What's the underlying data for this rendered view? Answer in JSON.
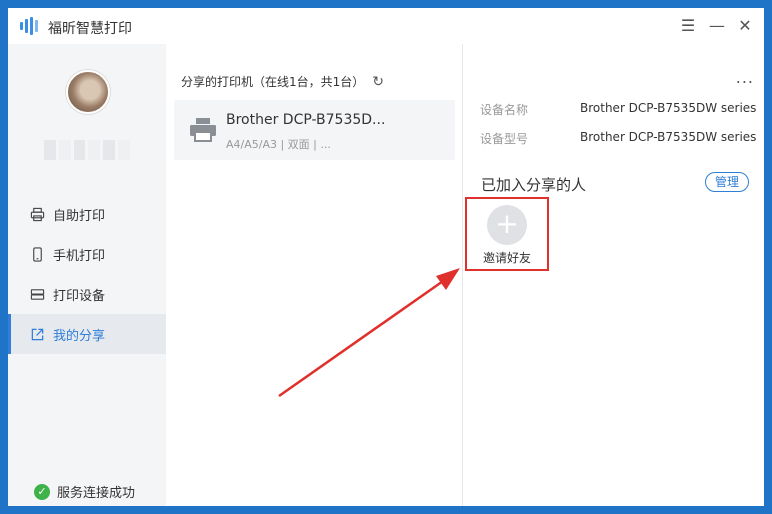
{
  "app": {
    "title": "福昕智慧打印"
  },
  "window_controls": {
    "menu": "☰",
    "minimize": "—",
    "close": "✕"
  },
  "sidebar": {
    "items": [
      {
        "label": "自助打印",
        "icon": "printer-icon"
      },
      {
        "label": "手机打印",
        "icon": "phone-icon"
      },
      {
        "label": "打印设备",
        "icon": "device-icon"
      },
      {
        "label": "我的分享",
        "icon": "share-icon",
        "active": true
      }
    ],
    "status": "服务连接成功"
  },
  "middle": {
    "header": "分享的打印机（在线1台，共1台）",
    "printer": {
      "name": "Brother DCP-B7535D...",
      "meta": "A4/A5/A3 | 双面 | ..."
    }
  },
  "right": {
    "more": "...",
    "device_name_label": "设备名称",
    "device_name_value": "Brother DCP-B7535DW series",
    "device_model_label": "设备型号",
    "device_model_value": "Brother DCP-B7535DW series",
    "shared_title": "已加入分享的人",
    "manage_label": "管理",
    "invite_label": "邀请好友",
    "invite_plus": "+"
  },
  "colors": {
    "accent": "#2f7ed8",
    "highlight_red": "#e0302b",
    "success": "#3fb24a",
    "desktop": "#1f74c8"
  }
}
